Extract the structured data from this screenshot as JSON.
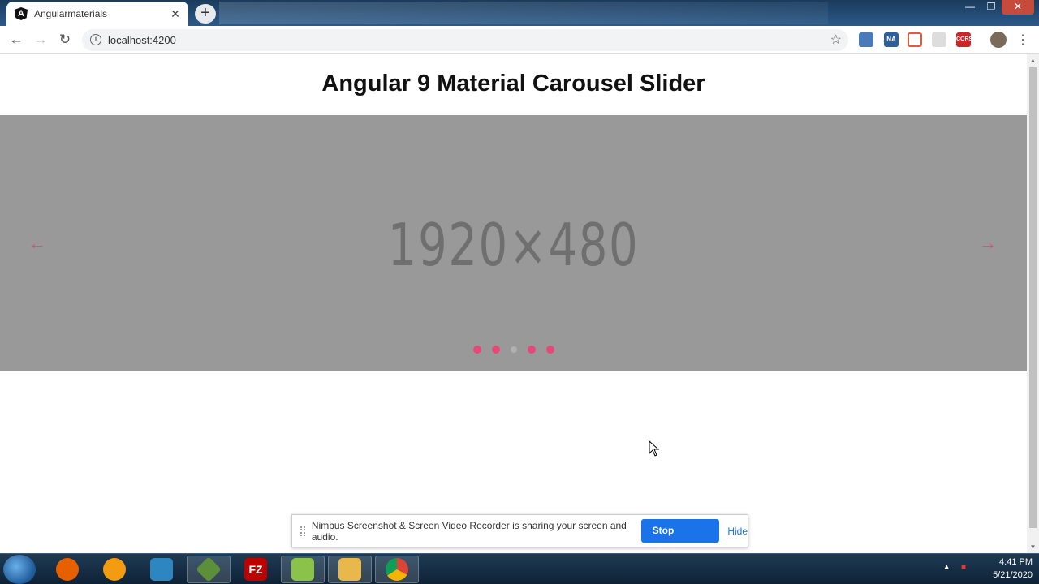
{
  "browser": {
    "tab_title": "Angularmaterials",
    "tab_close": "✕",
    "new_tab": "+",
    "url": "localhost:4200",
    "window_controls": {
      "minimize": "—",
      "maximize": "❐",
      "close": "✕"
    },
    "extensions": [
      {
        "name": "nimbus-icon",
        "color": "#4a7ab8"
      },
      {
        "name": "na-extension-icon",
        "color": "#2d5f9c"
      },
      {
        "name": "record-icon",
        "color": "#e35a3b"
      },
      {
        "name": "shield-icon",
        "color": "#bbbbbb"
      },
      {
        "name": "cors-icon",
        "color": "#c62828"
      }
    ],
    "extension_labels": {
      "cors": "CORS",
      "na": "NA"
    }
  },
  "page": {
    "title": "Angular 9 Material Carousel Slider",
    "carousel": {
      "placeholder_text": "1920×480",
      "prev_arrow": "←",
      "next_arrow": "→",
      "slide_count": 5,
      "active_slide_index": 2,
      "accent_color": "#e8477a"
    }
  },
  "sharing_bar": {
    "message": "Nimbus Screenshot & Screen Video Recorder is sharing your screen and audio.",
    "stop_label": "Stop sharing",
    "hide_label": "Hide"
  },
  "taskbar": {
    "apps": [
      {
        "name": "firefox-icon",
        "color": "#e66000"
      },
      {
        "name": "app-orange-icon",
        "color": "#f39c12"
      },
      {
        "name": "app-blue-hex-icon",
        "color": "#2e86c1"
      },
      {
        "name": "app-diamond-icon",
        "color": "#5d8f3a"
      },
      {
        "name": "filezilla-icon",
        "color": "#bf0000",
        "label": "FZ"
      },
      {
        "name": "notepad-plus-icon",
        "color": "#8bc34a"
      },
      {
        "name": "file-explorer-icon",
        "color": "#e8b84a"
      },
      {
        "name": "chrome-icon",
        "color": "#4285f4"
      }
    ],
    "time": "4:41 PM",
    "date": "5/21/2020"
  }
}
